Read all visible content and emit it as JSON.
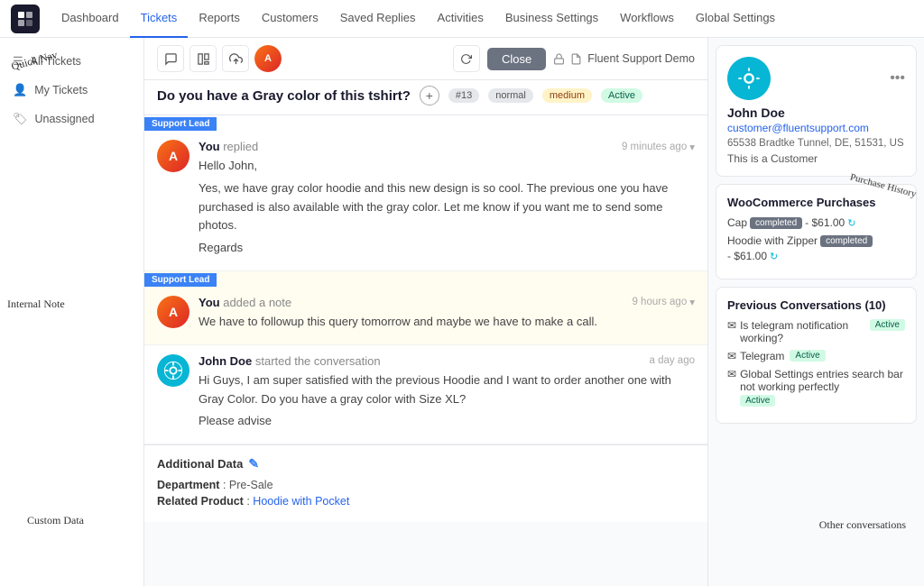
{
  "nav": {
    "logo_alt": "Fluent Support",
    "items": [
      {
        "label": "Dashboard",
        "active": false
      },
      {
        "label": "Tickets",
        "active": true
      },
      {
        "label": "Reports",
        "active": false
      },
      {
        "label": "Customers",
        "active": false
      },
      {
        "label": "Saved Replies",
        "active": false
      },
      {
        "label": "Activities",
        "active": false
      },
      {
        "label": "Business Settings",
        "active": false
      },
      {
        "label": "Workflows",
        "active": false
      },
      {
        "label": "Global Settings",
        "active": false
      }
    ]
  },
  "sidebar": {
    "items": [
      {
        "label": "All Tickets",
        "icon": "🎫"
      },
      {
        "label": "My Tickets",
        "icon": "👤"
      },
      {
        "label": "Unassigned",
        "icon": "🏷️"
      }
    ]
  },
  "ticket": {
    "title": "Do you have a Gray color of this tshirt?",
    "number": "#13",
    "priority": "normal",
    "type": "medium",
    "status": "Active",
    "business": "Fluent Support Demo",
    "close_label": "Close"
  },
  "messages": [
    {
      "type": "reply",
      "badge": "Support Lead",
      "author": "You",
      "action": "replied",
      "time": "9 minutes ago",
      "avatar_type": "img",
      "lines": [
        "Hello John,",
        "Yes, we have gray color hoodie and this new design is so cool. The previous one you have purchased is also available with the gray color. Let me know if you want me to send some photos.",
        "Regards"
      ]
    },
    {
      "type": "note",
      "badge": "Support Lead",
      "author": "You",
      "action": "added a note",
      "time": "9 hours ago",
      "avatar_type": "img",
      "lines": [
        "We have to followup this query tomorrow and maybe we have to make a call."
      ]
    },
    {
      "type": "customer",
      "author": "John Doe",
      "action": "started the conversation",
      "time": "a day ago",
      "avatar_type": "circle",
      "lines": [
        "Hi Guys, I am super satisfied with the previous Hoodie and I want to order another one with Gray Color. Do you have a gray color with Size XL?",
        "Please advise"
      ]
    }
  ],
  "additional_data": {
    "title": "Additional Data",
    "department_label": "Department",
    "department_value": "Pre-Sale",
    "product_label": "Related Product",
    "product_value": "Hoodie with Pocket"
  },
  "customer": {
    "name": "John Doe",
    "email": "customer@fluentsupport.com",
    "address": "65538 Bradtke Tunnel, DE, 51531, US",
    "tag": "This is a Customer"
  },
  "woocommerce": {
    "title": "WooCommerce Purchases",
    "items": [
      {
        "name": "Cap",
        "status": "completed",
        "price": "- $61.00"
      },
      {
        "name": "Hoodie with Zipper",
        "status": "completed",
        "price": "- $61.00"
      }
    ]
  },
  "previous_conversations": {
    "title": "Previous Conversations (10)",
    "items": [
      {
        "text": "Is telegram notification working?",
        "badge": "Active",
        "badge_type": "active"
      },
      {
        "text": "Telegram",
        "badge": "Active",
        "badge_type": "active"
      },
      {
        "text": "Global Settings entries search bar not working perfectly",
        "badge": "Active",
        "badge_type": "active"
      }
    ]
  },
  "annotations": {
    "quick_nav": "Quick Nav",
    "internal_note": "Internal Note",
    "custom_data": "Custom Data",
    "purchase_history": "Purchase History",
    "other_conversations": "Other conversations"
  }
}
